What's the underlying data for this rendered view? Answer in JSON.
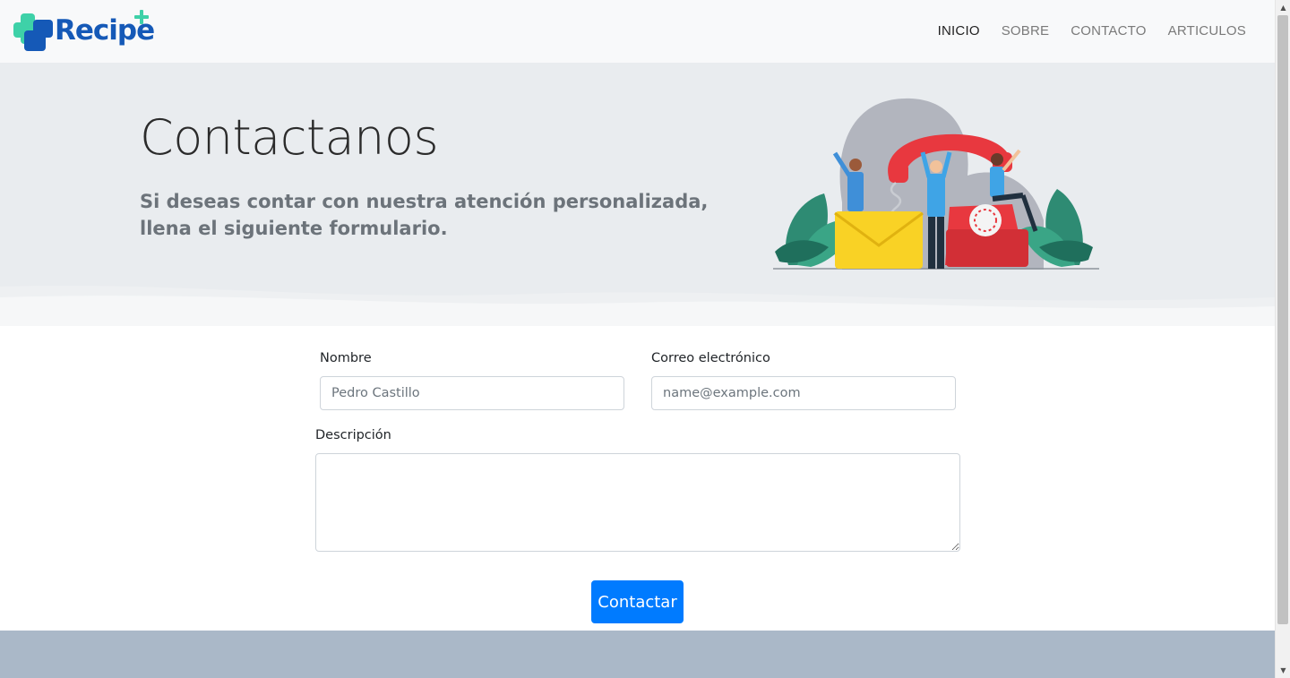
{
  "brand": {
    "name": "Recipe",
    "logo_icon": "medical-cross-logo-icon",
    "colors": {
      "blue": "#1559b7",
      "teal": "#3ed1a8"
    }
  },
  "nav": {
    "items": [
      {
        "label": "INICIO",
        "active": true
      },
      {
        "label": "SOBRE",
        "active": false
      },
      {
        "label": "CONTACTO",
        "active": false
      },
      {
        "label": "ARTICULOS",
        "active": false
      }
    ]
  },
  "hero": {
    "title": "Contactanos",
    "subtitle": "Si deseas contar con nuestra atención personalizada, llena el siguiente formulario.",
    "illustration": "contact-phone-envelope-illustration"
  },
  "form": {
    "name_label": "Nombre",
    "name_placeholder": "Pedro Castillo",
    "email_label": "Correo electrónico",
    "email_placeholder": "name@example.com",
    "description_label": "Descripción",
    "description_value": "",
    "submit_label": "Contactar"
  },
  "colors": {
    "primary": "#007bff",
    "hero_bg": "#e9ecef",
    "footer_bg": "#aab8c8"
  }
}
